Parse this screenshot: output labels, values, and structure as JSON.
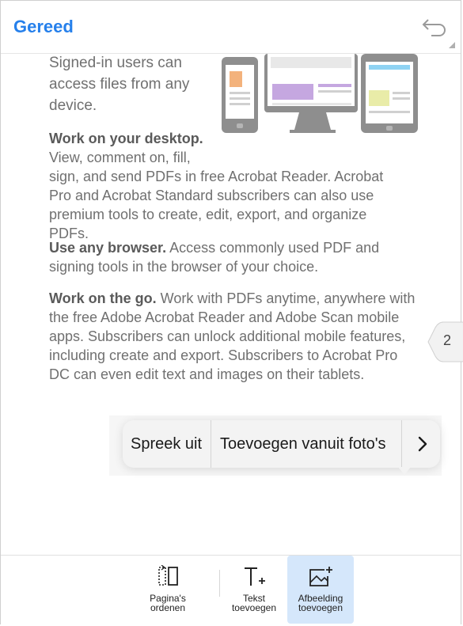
{
  "topbar": {
    "done_label": "Gereed"
  },
  "icons": {
    "undo": "undo-icon",
    "arrange_pages": "arrange-pages-icon",
    "add_text": "add-text-icon",
    "add_image": "add-image-icon",
    "chevron": "chevron-right-icon"
  },
  "document": {
    "signed_in": "Signed-in users can access files from any device.",
    "desktop_title": "Work on your desktop.",
    "desktop_line1": "View, comment on, fill,",
    "desktop_rest": "sign, and send PDFs in free Acrobat Reader. Acrobat Pro and Acrobat Standard subscribers can also use premium tools to create, edit, export, and organize PDFs.",
    "browser_title": "Use any browser.",
    "browser_text": " Access commonly used PDF and signing tools in the browser of your choice.",
    "go_title": "Work on the go.",
    "go_text": " Work with PDFs anytime, anywhere with the free Adobe Acrobat Reader and Adobe Scan mobile apps. Subscribers can unlock additional mobile features, including create and export. Subscribers to Acrobat Pro DC can even edit text and images on their tablets."
  },
  "page_indicator": "2",
  "popup": {
    "speak": "Spreek uit",
    "add_from_photos": "Toevoegen vanuit foto's"
  },
  "toolbar": {
    "arrange_pages": "Pagina's\nordenen",
    "add_text": "Tekst\ntoevoegen",
    "add_image": "Afbeelding\ntoevoegen"
  },
  "colors": {
    "accent": "#2680eb",
    "active_tool_bg": "#d5e7fb"
  }
}
